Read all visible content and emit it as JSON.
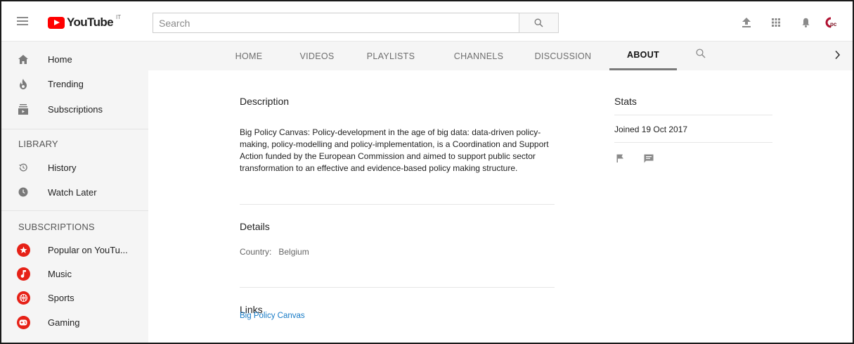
{
  "header": {
    "logo_text": "YouTube",
    "logo_country": "IT",
    "search_placeholder": "Search",
    "icons": [
      "menu-icon",
      "upload-icon",
      "apps-grid-icon",
      "notifications-bell-icon",
      "account-avatar"
    ],
    "avatar_text": "Gʙc"
  },
  "sidebar": {
    "main": [
      {
        "label": "Home",
        "icon": "home-icon"
      },
      {
        "label": "Trending",
        "icon": "flame-icon"
      },
      {
        "label": "Subscriptions",
        "icon": "subscriptions-icon"
      }
    ],
    "library_heading": "LIBRARY",
    "library": [
      {
        "label": "History",
        "icon": "history-icon"
      },
      {
        "label": "Watch Later",
        "icon": "clock-icon"
      }
    ],
    "subscriptions_heading": "SUBSCRIPTIONS",
    "subscriptions": [
      {
        "label": "Popular on YouTu...",
        "icon": "star-icon"
      },
      {
        "label": "Music",
        "icon": "music-note-icon"
      },
      {
        "label": "Sports",
        "icon": "basketball-icon"
      },
      {
        "label": "Gaming",
        "icon": "gamepad-icon"
      }
    ]
  },
  "tabs": {
    "items": [
      "HOME",
      "VIDEOS",
      "PLAYLISTS",
      "CHANNELS",
      "DISCUSSION",
      "ABOUT"
    ],
    "active": "ABOUT"
  },
  "about": {
    "description_title": "Description",
    "description_text": "Big Policy Canvas: Policy-development in the age of big data: data-driven policy-making, policy-modelling and policy-implementation, is a Coordination and Support Action funded by the European Commission and aimed to support public sector transformation to an effective and evidence-based policy making structure.",
    "details_title": "Details",
    "country_label": "Country:",
    "country_value": "Belgium",
    "links_title": "Links",
    "link_label": "Big Policy Canvas"
  },
  "stats": {
    "title": "Stats",
    "joined": "Joined 19 Oct 2017"
  },
  "colors": {
    "brand_red": "#ff0000",
    "link_blue": "#167ac6",
    "sidebar_bg": "#f5f5f5"
  }
}
